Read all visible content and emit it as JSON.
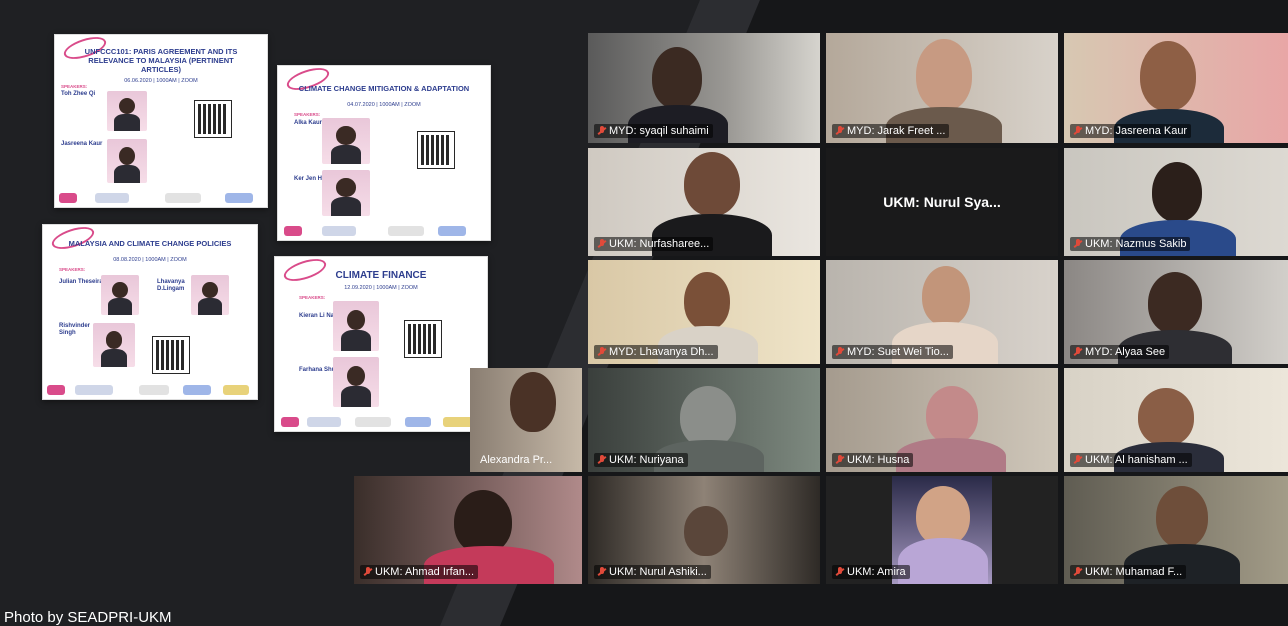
{
  "caption": "Photo by SEADPRI-UKM",
  "posters": [
    {
      "title": "UNFCCC101: PARIS AGREEMENT AND ITS RELEVANCE TO MALAYSIA (PERTINENT ARTICLES)",
      "date": "06.06.2020 | 1000AM | ZOOM",
      "speakers_heading": "SPEAKERS:",
      "speakers": [
        "Toh Zhee Qi",
        "Jasreena Kaur"
      ],
      "logo": "seadpri"
    },
    {
      "title": "CLIMATE CHANGE MITIGATION & ADAPTATION",
      "date": "04.07.2020 | 1000AM | ZOOM",
      "speakers_heading": "SPEAKERS:",
      "speakers": [
        "Alka Kaur",
        "Ker Jen Ho"
      ],
      "logo": "seadpri"
    },
    {
      "title": "MALAYSIA AND CLIMATE CHANGE POLICIES",
      "date": "08.08.2020 | 1000AM | ZOOM",
      "speakers_heading": "SPEAKERS:",
      "speakers": [
        "Julian Theseira",
        "Lhavanya D.Lingam",
        "Rishvinder Singh"
      ],
      "logo": "seadpri"
    },
    {
      "title": "CLIMATE FINANCE",
      "date": "12.09.2020 | 1000AM | ZOOM",
      "speakers_heading": "SPEAKERS:",
      "speakers": [
        "Kieran Li Nair",
        "Farhana Shukor"
      ],
      "logo": "seadpri"
    }
  ],
  "participants": [
    {
      "name": "MYD: syaqil suhaimi",
      "muted": true
    },
    {
      "name": "MYD: Jarak Freet ...",
      "muted": true
    },
    {
      "name": "MYD: Jasreena Kaur",
      "muted": true
    },
    {
      "name": "UKM: Nurfasharee...",
      "muted": true
    },
    {
      "name": "UKM: Nurul Sya...",
      "muted": false,
      "no_video": true
    },
    {
      "name": "UKM: Nazmus Sakib",
      "muted": true
    },
    {
      "name": "MYD: Lhavanya Dh...",
      "muted": true
    },
    {
      "name": "MYD: Suet Wei Tio...",
      "muted": true
    },
    {
      "name": "MYD: Alyaa See",
      "muted": true
    },
    {
      "name": "Alexandra Pr...",
      "muted": false
    },
    {
      "name": "UKM: Nuriyana",
      "muted": true
    },
    {
      "name": "UKM: Husna",
      "muted": true
    },
    {
      "name": "UKM: Al hanisham ...",
      "muted": true
    },
    {
      "name": "UKM: Ahmad Irfan...",
      "muted": true
    },
    {
      "name": "UKM: Nurul Ashiki...",
      "muted": true
    },
    {
      "name": "UKM: Amira",
      "muted": true
    },
    {
      "name": "UKM: Muhamad F...",
      "muted": true
    }
  ],
  "colors": {
    "poster_title": "#2d3d8e",
    "poster_accent": "#d94b8a",
    "mute_icon": "#e04a3a",
    "background": "#222326"
  }
}
